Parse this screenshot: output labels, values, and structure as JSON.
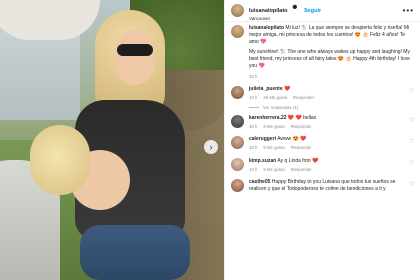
{
  "header": {
    "username": "luisanalopilato",
    "follow_label": "Seguir",
    "location": "Vancouver",
    "more_label": "•••"
  },
  "nav": {
    "next_label": "›"
  },
  "caption": {
    "username": "luisanalopilato",
    "text_es": "Mi luz! 🐩 La que siempre se despierta feliz y riseña! Mi mejor amiga, mi princesa de todos los cuentos! 😍 🎂 Feliz 4 años! Te amo 💖",
    "text_en": "My sunshine! 🐩 The one who always wakes up happy and laughing! My best friend, my princess of all fairy tales 😍 🎂 Happy 4th birthday! I love you 💖",
    "time": "18 h"
  },
  "comments": [
    {
      "username": "julieta_puente",
      "text": "❤️",
      "time": "18 h",
      "likes": "46 Me gusta",
      "reply": "Responder"
    },
    {
      "username": "karenherrera.22",
      "text": "❤️ ❤️ bellas",
      "time": "18 h",
      "likes": "5 Me gusta",
      "reply": "Responder"
    },
    {
      "username": "caleruggeri",
      "text": "Awww 😍 ❤️",
      "time": "18 h",
      "likes": "5 Me gusta",
      "reply": "Responder"
    },
    {
      "username": "kimp.suzan",
      "text": "Ay q Linda foto ❤️",
      "time": "18 h",
      "likes": "5 Me gusta",
      "reply": "Responder"
    },
    {
      "username": "casthe05",
      "text": "Happy Birthday to you Luisana que todos tus sueños se realicen y que el Todopoderoso te colme de bendiciones a ti y",
      "time": "",
      "likes": "",
      "reply": ""
    }
  ],
  "view_replies_label": "Ver respuestas (1)",
  "like_icon": "♡"
}
